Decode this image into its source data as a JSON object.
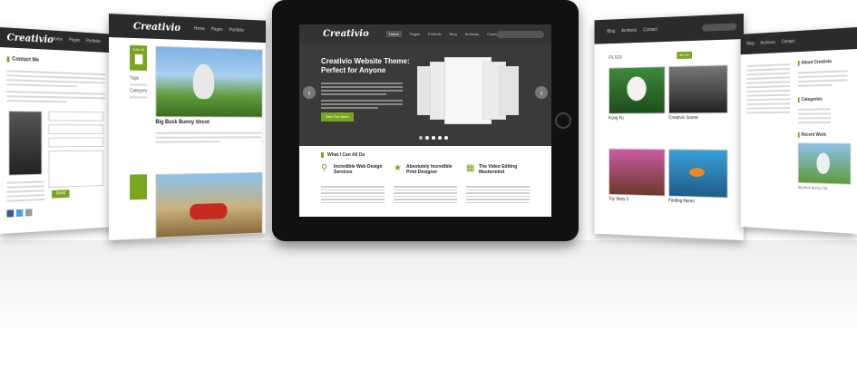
{
  "contact_card": {
    "logo": "Creativio",
    "nav": [
      "Home",
      "Pages",
      "Portfolio"
    ],
    "heading": "Contact Me",
    "send_label": "Send"
  },
  "blog_card": {
    "logo": "Creativio",
    "nav": [
      "Home",
      "Pages",
      "Portfolio"
    ],
    "post1_title": "Big Buck Bunny Shoot",
    "date_label": "JUN 15",
    "meta_tags": "Tags",
    "meta_category": "Category"
  },
  "portfolio_card": {
    "nav": [
      "Blog",
      "Archives",
      "Contact"
    ],
    "filter_label": "FILTER",
    "tab_label": "BLOG",
    "item1": "Creativio Scene",
    "item2": "Kung Fu",
    "item3": "Toy Story 3",
    "item4": "Finding Nemo"
  },
  "about_card": {
    "nav": [
      "Blog",
      "Archives",
      "Contact"
    ],
    "heading1": "About Creativio",
    "heading2": "Categories",
    "heading3": "Recent Work",
    "caption": "Big Buck Bunny Clip"
  },
  "tablet": {
    "logo": "Creativio",
    "nav": [
      "Home",
      "Pages",
      "Portfolio",
      "Blog",
      "Archives",
      "Contact"
    ],
    "hero_title": "Creativio Website Theme: Perfect for Anyone",
    "hero_button": "See Our Work",
    "section_title": "What I Can All Do",
    "col1_title": "Incredible Web Design Services",
    "col2_title": "Absolutely Incredible Print Designer",
    "col3_title": "The Video Editing Mastermind"
  },
  "icons": {
    "search": "search-icon",
    "star": "star-icon",
    "film": "film-icon"
  },
  "colors": {
    "accent": "#7aa51e",
    "dark": "#2b2b2b"
  }
}
